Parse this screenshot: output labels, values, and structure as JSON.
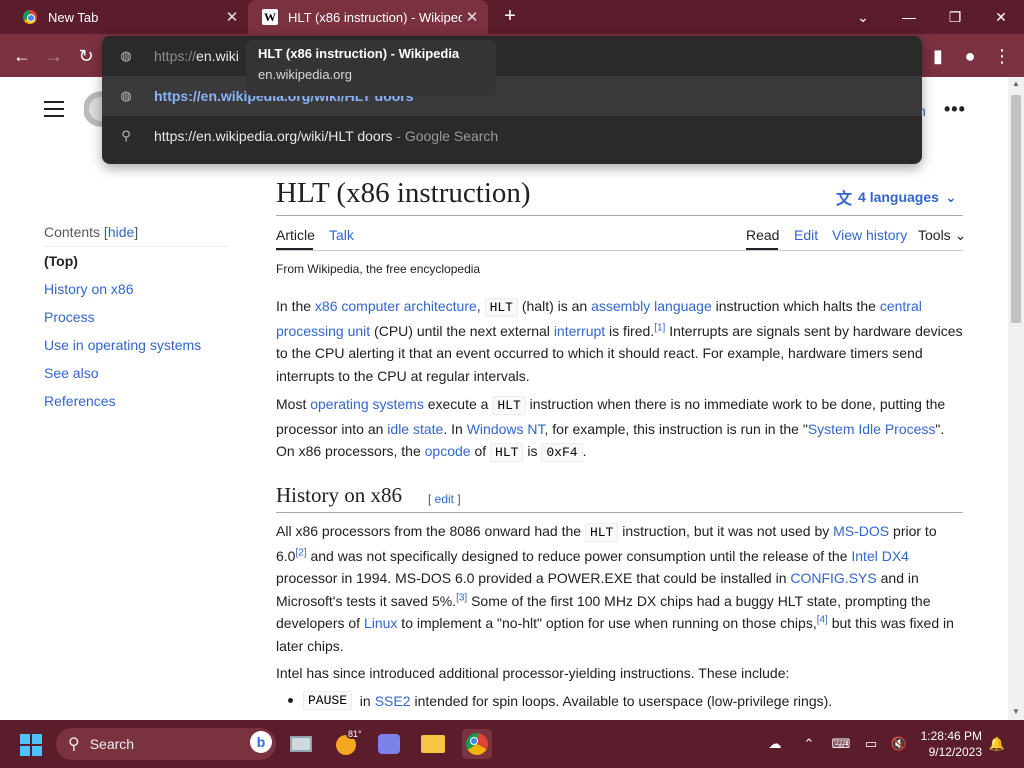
{
  "browser": {
    "tabs": [
      {
        "title": "New Tab"
      },
      {
        "title": "HLT (x86 instruction) - Wikipedia"
      }
    ],
    "omnibox": {
      "typed_prefix": "https://",
      "typed_host": "en.wiki",
      "suggestion_url": "https://en.wikipedia.org/wiki/HLT doors",
      "search_text": "https://en.wikipedia.org/wiki/HLT doors",
      "search_suffix": " - Google Search"
    },
    "tooltip": {
      "title": "HLT (x86 instruction) - Wikipedia",
      "host": "en.wikipedia.org"
    }
  },
  "page": {
    "login_partial": "n",
    "toc": {
      "title": "Contents",
      "hide": "hide",
      "items": [
        "(Top)",
        "History on x86",
        "Process",
        "Use in operating systems",
        "See also",
        "References"
      ]
    },
    "title": "HLT (x86 instruction)",
    "languages": "4 languages",
    "tabs": {
      "article": "Article",
      "talk": "Talk",
      "read": "Read",
      "edit": "Edit",
      "history": "View history",
      "tools": "Tools"
    },
    "from": "From Wikipedia, the free encyclopedia",
    "section": {
      "heading": "History on x86",
      "edit": "edit"
    }
  },
  "taskbar": {
    "search_label": "Search",
    "weather_temp": "81°",
    "time": "1:28:46 PM",
    "date": "9/12/2023"
  },
  "colors": {
    "link": "#3366cc",
    "accent_taskbar": "#5b1c2b",
    "tab_active": "#7a3140"
  }
}
